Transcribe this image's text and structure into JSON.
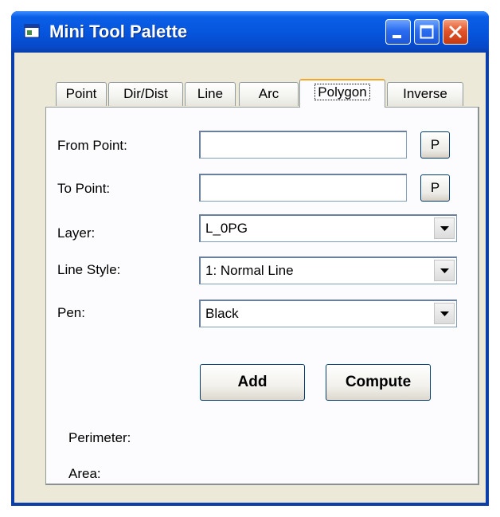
{
  "window": {
    "title": "Mini Tool Palette",
    "accent_color": "#0654dc",
    "close_color": "#e2552c"
  },
  "tabs": [
    {
      "label": "Point",
      "active": false
    },
    {
      "label": "Dir/Dist",
      "active": false
    },
    {
      "label": "Line",
      "active": false
    },
    {
      "label": "Arc",
      "active": false
    },
    {
      "label": "Polygon",
      "active": true
    },
    {
      "label": "Inverse",
      "active": false
    }
  ],
  "form": {
    "from_point": {
      "label": "From Point:",
      "value": "",
      "pick_label": "P"
    },
    "to_point": {
      "label": "To Point:",
      "value": "",
      "pick_label": "P"
    },
    "layer": {
      "label": "Layer:",
      "value": "L_0PG"
    },
    "line_style": {
      "label": "Line Style:",
      "value": "1: Normal Line"
    },
    "pen": {
      "label": "Pen:",
      "value": "Black"
    }
  },
  "actions": {
    "add_label": "Add",
    "compute_label": "Compute"
  },
  "results": {
    "perimeter_label": "Perimeter:",
    "area_label": "Area:"
  }
}
